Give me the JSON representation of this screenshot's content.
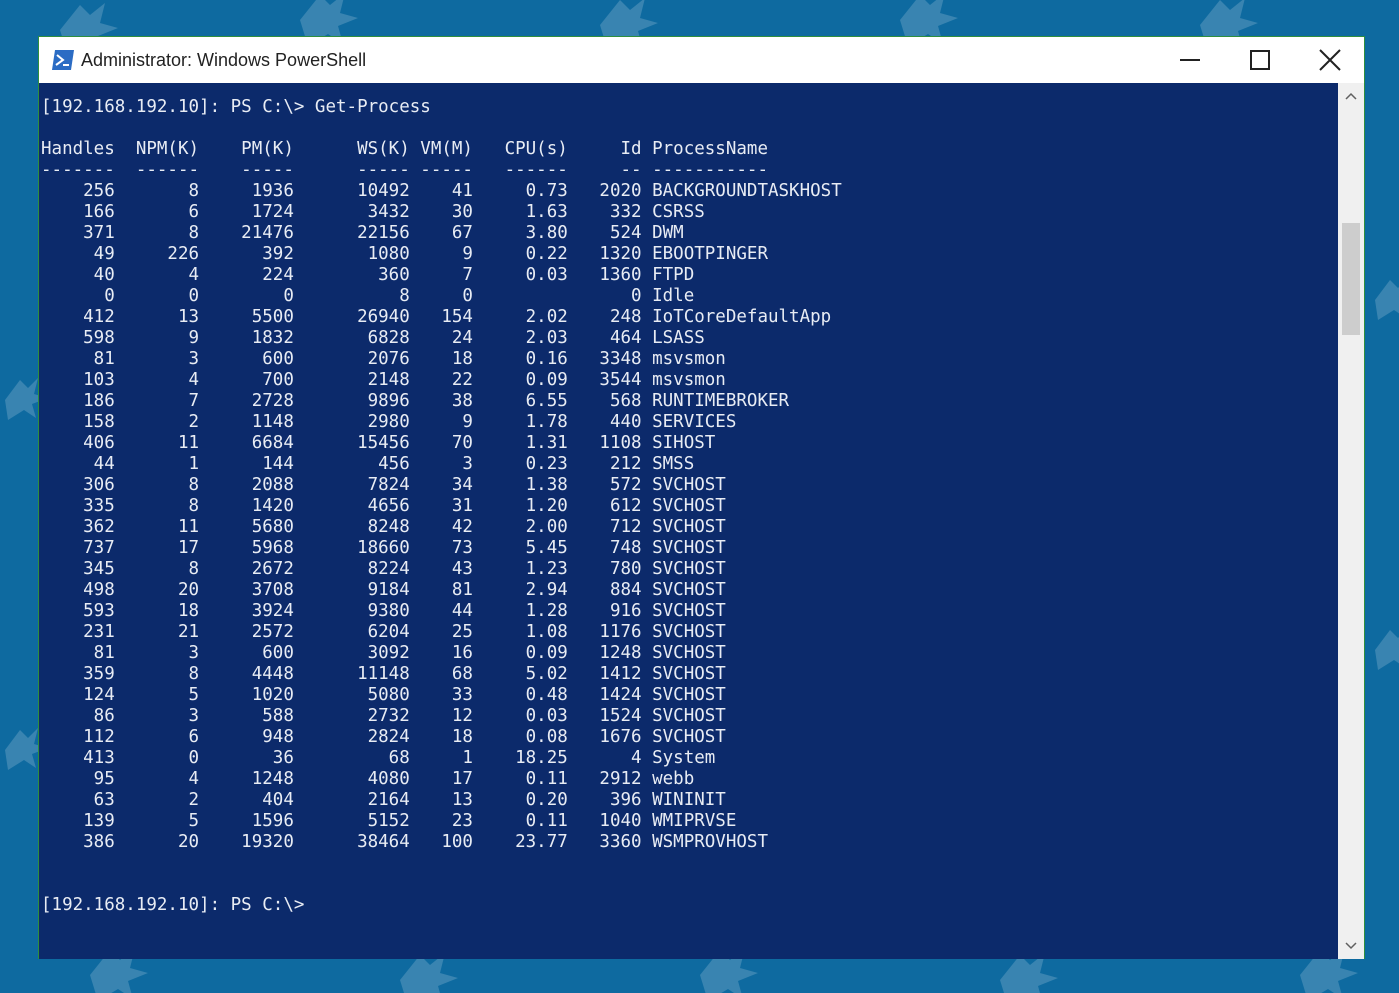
{
  "window": {
    "title": "Administrator: Windows PowerShell",
    "icon": "powershell-icon",
    "controls": [
      "minimize-icon",
      "maximize-icon",
      "close-icon"
    ]
  },
  "console": {
    "prompt_command": "[192.168.192.10]: PS C:\\> Get-Process",
    "header": "Handles  NPM(K)    PM(K)      WS(K) VM(M)   CPU(s)     Id ProcessName",
    "separator": "-------  ------    -----      ----- -----   ------     -- -----------",
    "rows": [
      "    256       8     1936      10492    41     0.73   2020 BACKGROUNDTASKHOST",
      "    166       6     1724       3432    30     1.63    332 CSRSS",
      "    371       8    21476      22156    67     3.80    524 DWM",
      "     49     226      392       1080     9     0.22   1320 EBOOTPINGER",
      "     40       4      224        360     7     0.03   1360 FTPD",
      "      0       0        0          8     0               0 Idle",
      "    412      13     5500      26940   154     2.02    248 IoTCoreDefaultApp",
      "    598       9     1832       6828    24     2.03    464 LSASS",
      "     81       3      600       2076    18     0.16   3348 msvsmon",
      "    103       4      700       2148    22     0.09   3544 msvsmon",
      "    186       7     2728       9896    38     6.55    568 RUNTIMEBROKER",
      "    158       2     1148       2980     9     1.78    440 SERVICES",
      "    406      11     6684      15456    70     1.31   1108 SIHOST",
      "     44       1      144        456     3     0.23    212 SMSS",
      "    306       8     2088       7824    34     1.38    572 SVCHOST",
      "    335       8     1420       4656    31     1.20    612 SVCHOST",
      "    362      11     5680       8248    42     2.00    712 SVCHOST",
      "    737      17     5968      18660    73     5.45    748 SVCHOST",
      "    345       8     2672       8224    43     1.23    780 SVCHOST",
      "    498      20     3708       9184    81     2.94    884 SVCHOST",
      "    593      18     3924       9380    44     1.28    916 SVCHOST",
      "    231      21     2572       6204    25     1.08   1176 SVCHOST",
      "     81       3      600       3092    16     0.09   1248 SVCHOST",
      "    359       8     4448      11148    68     5.02   1412 SVCHOST",
      "    124       5     1020       5080    33     0.48   1424 SVCHOST",
      "     86       3      588       2732    12     0.03   1524 SVCHOST",
      "    112       6      948       2824    18     0.08   1676 SVCHOST",
      "    413       0       36         68     1    18.25      4 System",
      "     95       4     1248       4080    17     0.11   2912 webb",
      "     63       2      404       2164    13     0.20    396 WININIT",
      "    139       5     1596       5152    23     0.11   1040 WMIPRVSE",
      "    386      20    19320      38464   100    23.77   3360 WSMPROVHOST"
    ],
    "blank": "",
    "final_prompt": "[192.168.192.10]: PS C:\\>"
  },
  "colors": {
    "desktop": "#0e6aa0",
    "console_bg": "#0c2a6b",
    "console_text": "#e8ecf4"
  }
}
